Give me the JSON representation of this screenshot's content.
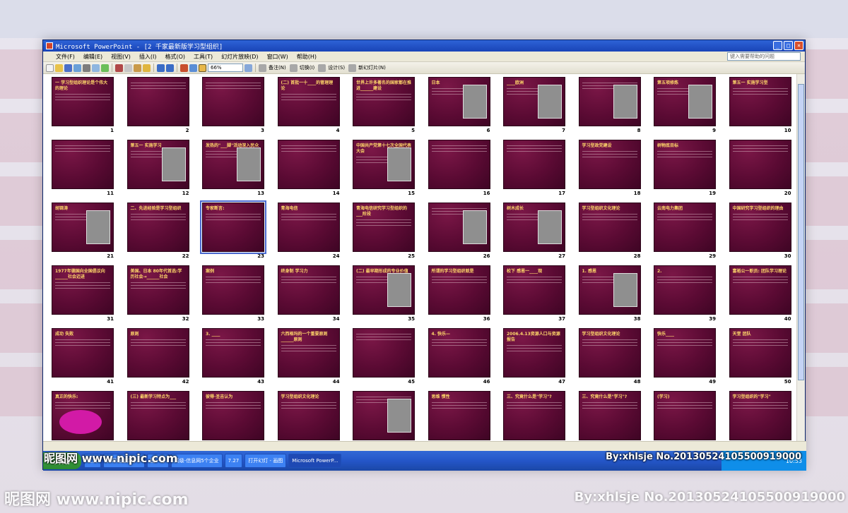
{
  "window": {
    "title": "Microsoft PowerPoint - [2  千家最新版学习型组织]"
  },
  "menu": {
    "items": [
      "文件(F)",
      "编辑(E)",
      "视图(V)",
      "插入(I)",
      "格式(O)",
      "工具(T)",
      "幻灯片放映(D)",
      "窗口(W)",
      "帮助(H)"
    ],
    "help_placeholder": "键入需要帮助的问题"
  },
  "toolbar": {
    "zoom": "66%",
    "labels": [
      "备注(N)",
      "切换(I)",
      "设计(S)",
      "新幻灯片(N)"
    ]
  },
  "slides": [
    {
      "num": "1",
      "title": "一 学习型组织理论是个伟大的理论"
    },
    {
      "num": "2",
      "title": ""
    },
    {
      "num": "3",
      "title": ""
    },
    {
      "num": "4",
      "title": "(二) 首批一十____的管理理论"
    },
    {
      "num": "5",
      "title": "世界上许多著名的国家都在推进______建设"
    },
    {
      "num": "6",
      "title": "日本"
    },
    {
      "num": "7",
      "title": "____欧洲"
    },
    {
      "num": "8",
      "title": ""
    },
    {
      "num": "9",
      "title": "第五项修炼"
    },
    {
      "num": "10",
      "title": "第五一 实施学习型"
    },
    {
      "num": "11",
      "title": ""
    },
    {
      "num": "12",
      "title": "第五一 实施学习"
    },
    {
      "num": "13",
      "title": "发热的\"___脚\"活动深入民众"
    },
    {
      "num": "14",
      "title": ""
    },
    {
      "num": "15",
      "title": "中国共产党第十七次全国代表大会"
    },
    {
      "num": "16",
      "title": ""
    },
    {
      "num": "17",
      "title": ""
    },
    {
      "num": "18",
      "title": "学习型政党建设"
    },
    {
      "num": "19",
      "title": "树物底目标"
    },
    {
      "num": "20",
      "title": ""
    },
    {
      "num": "21",
      "title": "胡锦涛"
    },
    {
      "num": "22",
      "title": "二、先进经验是学习型组织"
    },
    {
      "num": "23",
      "title": "专家断言:"
    },
    {
      "num": "24",
      "title": "青海电信"
    },
    {
      "num": "25",
      "title": "青海电信研究学习型组织的___阶段"
    },
    {
      "num": "26",
      "title": ""
    },
    {
      "num": "27",
      "title": "树木成长"
    },
    {
      "num": "28",
      "title": "学习型组织文化理论"
    },
    {
      "num": "29",
      "title": "云南电力集团"
    },
    {
      "num": "30",
      "title": "中国研究学习型组织的理由"
    },
    {
      "num": "31",
      "title": "1977年德国向全国倡议向______社会迈进"
    },
    {
      "num": "32",
      "title": "美国、日本 80年代首选:学历社会→______社会"
    },
    {
      "num": "33",
      "title": "案例"
    },
    {
      "num": "34",
      "title": "终身制 学习力"
    },
    {
      "num": "35",
      "title": "(二) 最早期形成的专业价值"
    },
    {
      "num": "36",
      "title": "所谓的学习型组织就是"
    },
    {
      "num": "37",
      "title": "松下 感恩一____观"
    },
    {
      "num": "38",
      "title": "1. 感恩"
    },
    {
      "num": "39",
      "title": "2."
    },
    {
      "num": "40",
      "title": "富裕公一职员: 团队学习理论"
    },
    {
      "num": "41",
      "title": "成功 失败"
    },
    {
      "num": "42",
      "title": "原则"
    },
    {
      "num": "43",
      "title": "3. ____"
    },
    {
      "num": "44",
      "title": "六西格玛的一个重要原则 ______原则"
    },
    {
      "num": "45",
      "title": ""
    },
    {
      "num": "46",
      "title": "4. 快乐—"
    },
    {
      "num": "47",
      "title": "2006.4.13资源人口与资源报告"
    },
    {
      "num": "48",
      "title": "学习型组织文化理论"
    },
    {
      "num": "49",
      "title": "快乐____"
    },
    {
      "num": "50",
      "title": "天堂 团队"
    },
    {
      "num": "51",
      "title": "真正的快乐:"
    },
    {
      "num": "52",
      "title": "(三) 最新学习特点为___"
    },
    {
      "num": "53",
      "title": "彼得·圣吉认为"
    },
    {
      "num": "54",
      "title": "学习型组织文化理论"
    },
    {
      "num": "55",
      "title": ""
    },
    {
      "num": "56",
      "title": "思维 惯性"
    },
    {
      "num": "57",
      "title": "三、究竟什么是\"学习\"?"
    },
    {
      "num": "58",
      "title": "三、究竟什么是\"学习\"?"
    },
    {
      "num": "59",
      "title": "(学习)"
    },
    {
      "num": "60",
      "title": "学习型组织的\"学习\""
    }
  ],
  "taskbar": {
    "start": "开始",
    "items": [
      "开始",
      "工具",
      "打印进度文件...",
      "图一份",
      "高级-信息网5个企业",
      "7.27",
      "打开幻灯 - 画图",
      "Microsoft PowerP..."
    ],
    "clock": "10:53"
  },
  "watermarks": {
    "site": "昵图网 www.nipic.com",
    "id": "By:xhlsje  No.20130524105500919000"
  }
}
